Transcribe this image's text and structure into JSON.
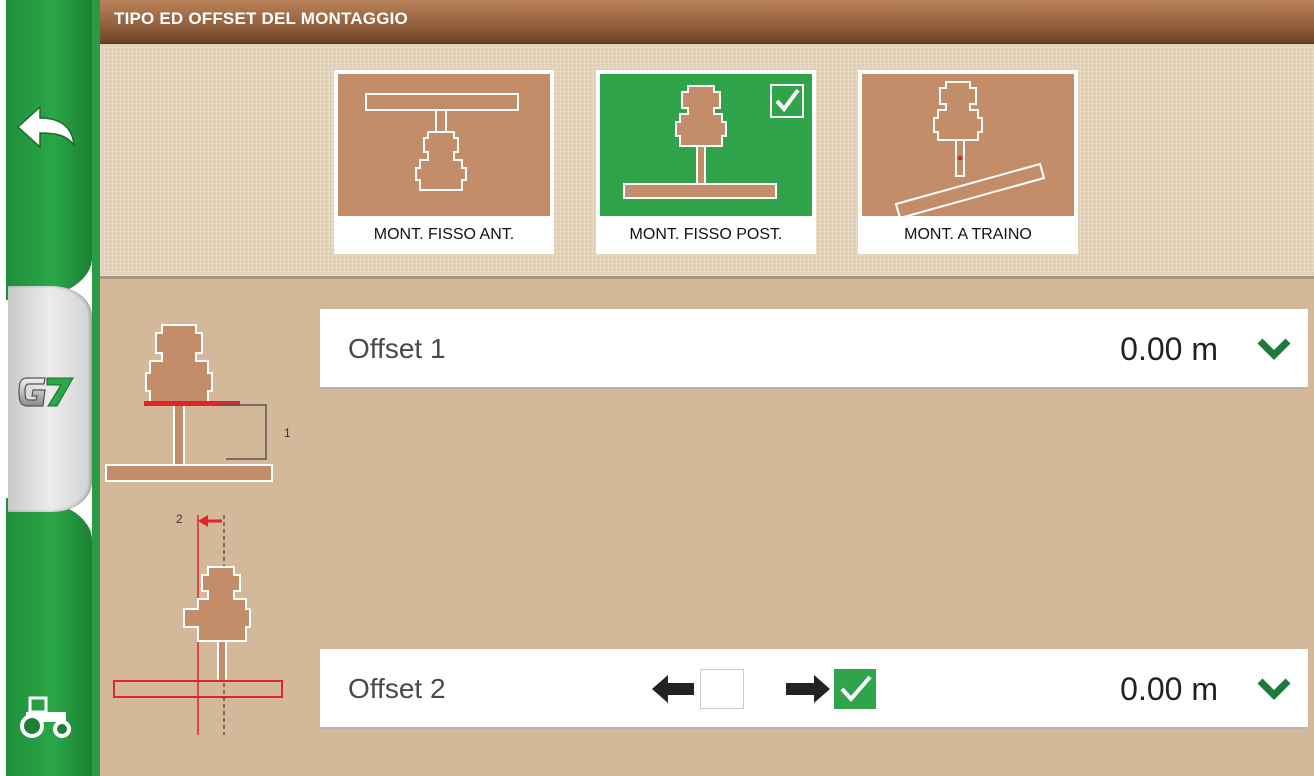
{
  "header": {
    "title": "TIPO ED OFFSET DEL MONTAGGIO"
  },
  "sidebar": {
    "items": [
      {
        "icon": "back-arrow-icon"
      },
      {
        "icon": "g7-logo-icon"
      },
      {
        "icon": "tractor-icon"
      }
    ]
  },
  "mounting_types": [
    {
      "label": "MONT. FISSO ANT.",
      "selected": false,
      "icon": "front-fixed-mount-icon"
    },
    {
      "label": "MONT. FISSO POST.",
      "selected": true,
      "icon": "rear-fixed-mount-icon"
    },
    {
      "label": "MONT. A TRAINO",
      "selected": false,
      "icon": "towed-mount-icon"
    }
  ],
  "offsets": {
    "offset1": {
      "label": "Offset 1",
      "value": "0.00 m",
      "diagram_marker": "1"
    },
    "offset2": {
      "label": "Offset 2",
      "value": "0.00 m",
      "diagram_marker": "2",
      "left_checked": false,
      "right_checked": true
    }
  },
  "colors": {
    "accent_green": "#30a44b",
    "brown_header": "#93603d",
    "panel_tan": "#d3b899",
    "tile_brown": "#c38d69",
    "marker_red": "#e0242a"
  }
}
